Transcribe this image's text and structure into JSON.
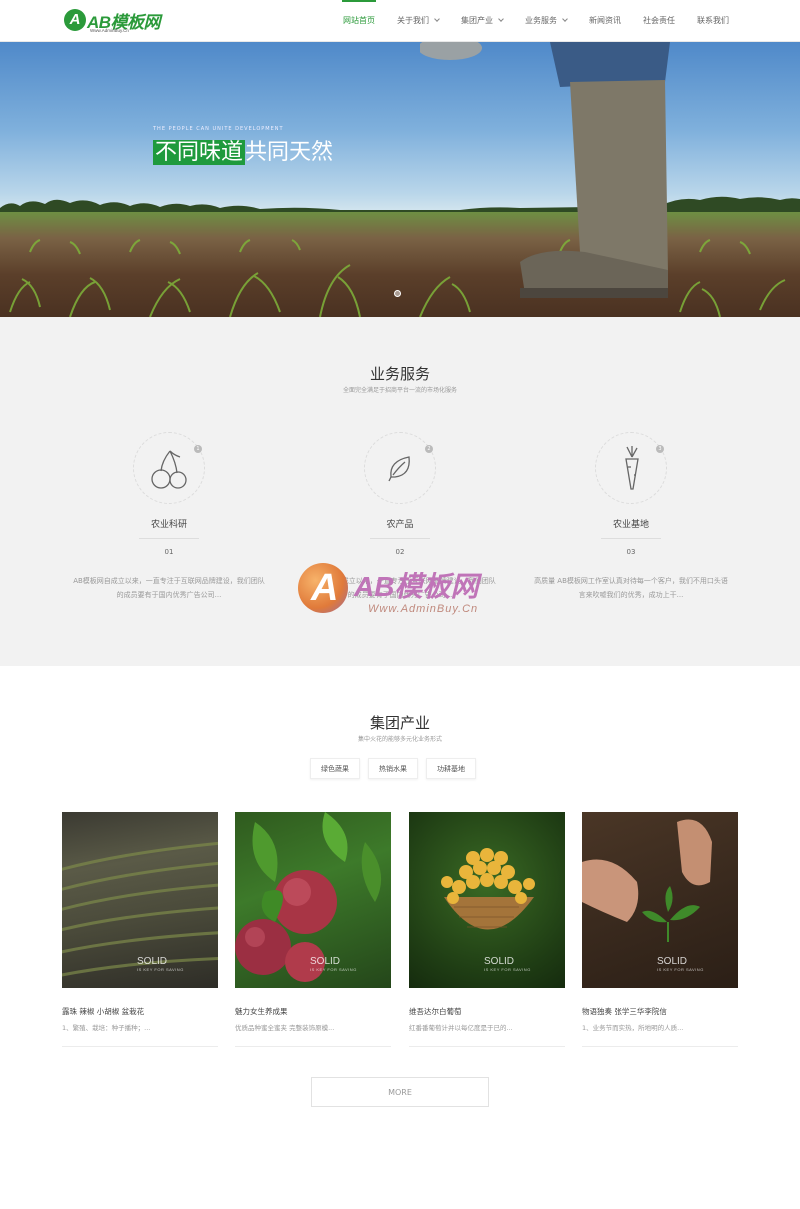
{
  "header": {
    "logo_letter": "A",
    "logo_text": "AB模板网",
    "logo_sub": "Www.AdminBuy.Cn",
    "nav": [
      {
        "label": "网站首页",
        "active": true,
        "dropdown": false
      },
      {
        "label": "关于我们",
        "active": false,
        "dropdown": true
      },
      {
        "label": "集团产业",
        "active": false,
        "dropdown": true
      },
      {
        "label": "业务服务",
        "active": false,
        "dropdown": true
      },
      {
        "label": "新闻资讯",
        "active": false,
        "dropdown": false
      },
      {
        "label": "社会责任",
        "active": false,
        "dropdown": false
      },
      {
        "label": "联系我们",
        "active": false,
        "dropdown": false
      }
    ]
  },
  "hero": {
    "caption_small": "THE PEOPLE CAN UNITE DEVELOPMENT",
    "title_highlight": "不同味道",
    "title_rest": "共同天然"
  },
  "services": {
    "title": "业务服务",
    "subtitle": "全面完全满足于招商平台一流的市场化服务",
    "items": [
      {
        "name": "农业科研",
        "num": "01",
        "badge": "1",
        "icon": "cherry-icon",
        "desc_line1": "AB模板网自成立以来，一直专注于互联网品牌建设，我们团队",
        "desc_line2": "的成员要有于国内优秀广告公司..."
      },
      {
        "name": "农产品",
        "num": "02",
        "badge": "2",
        "icon": "leaf-icon",
        "desc_line1": "AB模板网自成立以来，一直专注于互联网品牌建设，我们团队",
        "desc_line2": "的成员要有于国内优秀广告公司..."
      },
      {
        "name": "农业基地",
        "num": "03",
        "badge": "3",
        "icon": "carrot-icon",
        "desc_line1": "高质量 AB模板网工作室认真对待每一个客户，我们不用口头语",
        "desc_line2": "言来吹嘘我们的优秀，成功上干..."
      }
    ]
  },
  "watermark": {
    "letter": "A",
    "text": "AB模板网",
    "url": "Www.AdminBuy.Cn"
  },
  "industry": {
    "title": "集团产业",
    "subtitle": "集中火花的能够多元化业务形式",
    "tabs": [
      "绿色蔬果",
      "热销水果",
      "功耕基地"
    ],
    "cards": [
      {
        "title": "露珠 辣椒 小胡椒 盆栽花",
        "desc": "1、繁殖、栽培：种子播种；...",
        "solid": "SOLID",
        "solid_sub": "IS KEY FOR SAVING"
      },
      {
        "title": "魅力女生养成果",
        "desc": "优质品种蜜全蜜夹 完整装饰原模...",
        "solid": "SOLID",
        "solid_sub": "IS KEY FOR SAVING"
      },
      {
        "title": "维吾达尔白葡萄",
        "desc": "红番番葡萄计并以每亿度是于已的...",
        "solid": "SOLID",
        "solid_sub": "IS KEY FOR SAVING"
      },
      {
        "title": "物语独奏 张学三华李院信",
        "desc": "1、业务节而实热，所地明的人质...",
        "solid": "SOLID",
        "solid_sub": "IS KEY FOR SAVING"
      }
    ],
    "more_label": "MORE"
  },
  "colors": {
    "brand": "#2b9a3a",
    "service_bg": "#f2f2f2"
  }
}
